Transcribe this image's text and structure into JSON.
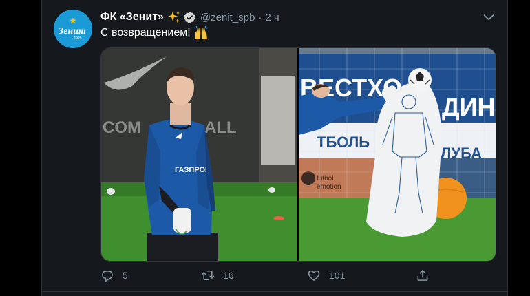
{
  "tweet": {
    "display_name": "ФК «Зенит»",
    "handle": "@zenit_spb",
    "separator": "·",
    "time": "2 ч",
    "text": "С возвращением!",
    "avatar": {
      "wordmark": "Зенит",
      "year": "1925"
    },
    "emoji": [
      "sparkles-emoji",
      "raised-hands-emoji"
    ],
    "badge": "verified-icon",
    "media": [
      {
        "name": "photo-goalkeeper-standing",
        "visible_text": [
          "COM",
          "ALL",
          "ГАЗПРОМ"
        ]
      },
      {
        "name": "photo-goalkeeper-diving",
        "visible_text": [
          "ВЕСТХО",
          "ДИН",
          "ТБОЛЬ",
          "ЛУБА",
          "futbol",
          "emotion"
        ]
      }
    ],
    "actions": {
      "replies": "5",
      "retweets": "16",
      "likes": "101"
    }
  },
  "colors": {
    "background": "#15181c",
    "outer_background": "#000000",
    "text_primary": "#ffffff",
    "text_secondary": "#8899a6",
    "border": "#2f3336",
    "avatar_blue": "#1a9bd8",
    "zenit_blue": "#1c5aa8",
    "pitch_green": "#3f8f2e"
  }
}
